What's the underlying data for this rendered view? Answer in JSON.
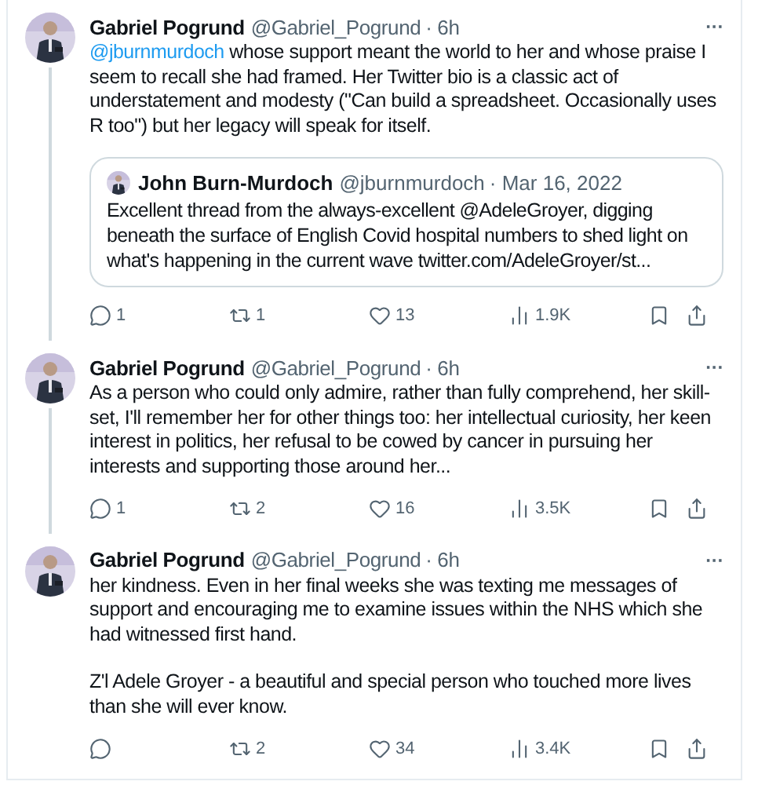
{
  "tweets": [
    {
      "author": "Gabriel Pogrund",
      "handle": "@Gabriel_Pogrund",
      "time": "· 6h",
      "more": "···",
      "paragraphs": [
        [
          {
            "kind": "mention",
            "text": "@jburnmurdoch"
          },
          {
            "kind": "text",
            "text": " whose support meant the world to her and whose praise I seem to recall she had framed. Her Twitter bio is a classic act of understatement and modesty (\"Can build a spreadsheet. Occasionally uses R too\") but her legacy will speak for itself."
          }
        ]
      ],
      "quote": {
        "author": "John Burn-Murdoch",
        "handle": "@jburnmurdoch",
        "time": "· Mar 16, 2022",
        "text": "Excellent thread from the always-excellent @AdeleGroyer, digging beneath the surface of English Covid hospital numbers to shed light on what's happening in the current wave twitter.com/AdeleGroyer/st..."
      },
      "actions": [
        {
          "kind": "reply",
          "count": "1"
        },
        {
          "kind": "retweet",
          "count": "1"
        },
        {
          "kind": "like",
          "count": "13"
        },
        {
          "kind": "views",
          "count": "1.9K"
        }
      ]
    },
    {
      "author": "Gabriel Pogrund",
      "handle": "@Gabriel_Pogrund",
      "time": "· 6h",
      "more": "···",
      "paragraphs": [
        [
          {
            "kind": "text",
            "text": "As a person who could only admire, rather than fully comprehend, her skill-set, I'll remember her for other things too: her intellectual curiosity, her keen interest in politics, her refusal to be cowed by cancer in pursuing her interests and supporting those around her..."
          }
        ]
      ],
      "actions": [
        {
          "kind": "reply",
          "count": "1"
        },
        {
          "kind": "retweet",
          "count": "2"
        },
        {
          "kind": "like",
          "count": "16"
        },
        {
          "kind": "views",
          "count": "3.5K"
        }
      ]
    },
    {
      "author": "Gabriel Pogrund",
      "handle": "@Gabriel_Pogrund",
      "time": "· 6h",
      "more": "···",
      "paragraphs": [
        [
          {
            "kind": "text",
            "text": "her kindness. Even in her final weeks she was texting me messages of support and encouraging me to examine issues within the NHS which she had witnessed first hand."
          }
        ],
        [
          {
            "kind": "text",
            "text": "Z'l Adele Groyer - a beautiful and special person who touched more lives than she will ever know."
          }
        ]
      ],
      "actions": [
        {
          "kind": "reply"
        },
        {
          "kind": "retweet",
          "count": "2"
        },
        {
          "kind": "like",
          "count": "34"
        },
        {
          "kind": "views",
          "count": "3.4K"
        }
      ]
    }
  ]
}
